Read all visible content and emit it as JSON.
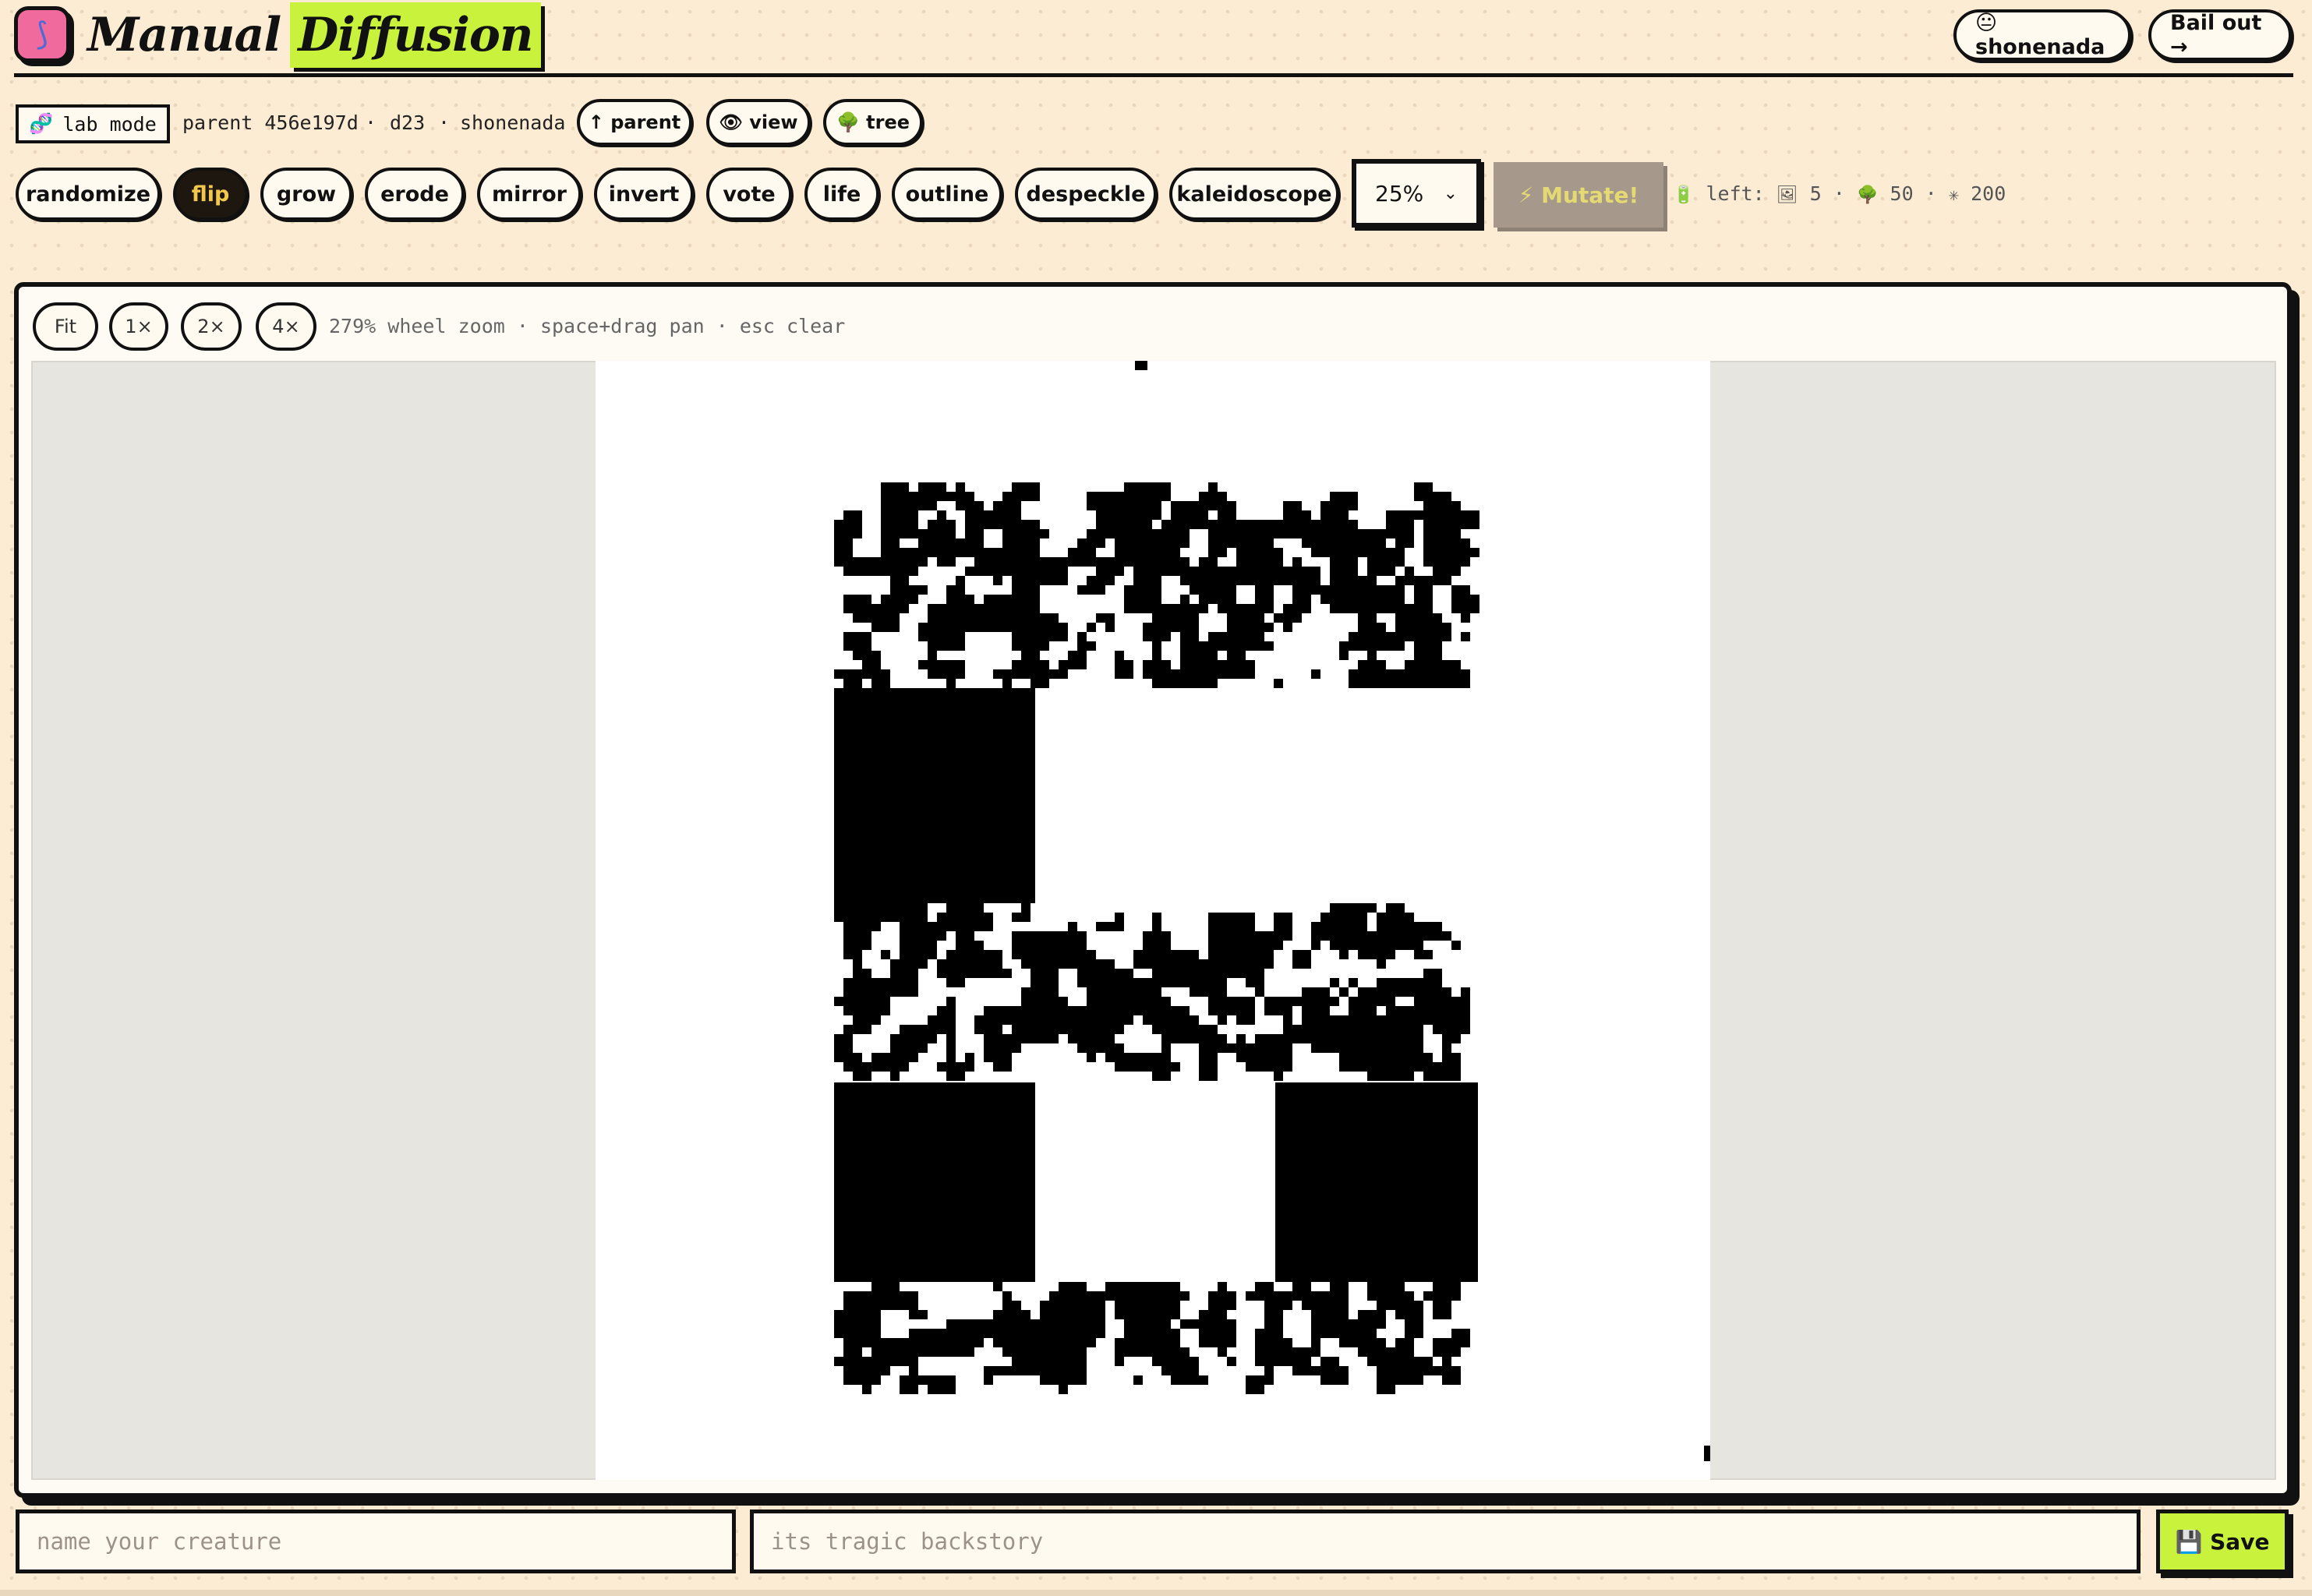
{
  "app": {
    "title_part1": "Manual",
    "title_part2": "Diffusion",
    "logo_icon": "dna-icon"
  },
  "header": {
    "user_label": "😐 shonenada",
    "bail_label": "Bail out →"
  },
  "lineage": {
    "lab_mode_label": "lab mode",
    "lab_mode_icon": "🧬",
    "parent_text": "parent 456e197d",
    "sep1": "·",
    "depth_text": "d23",
    "sep2": "·",
    "author_text": "shonenada",
    "parent_button": "↑ parent",
    "view_button": "👁 view",
    "tree_button": "🌳 tree"
  },
  "operations": [
    {
      "label": "randomize",
      "active": false
    },
    {
      "label": "flip",
      "active": true
    },
    {
      "label": "grow",
      "active": false
    },
    {
      "label": "erode",
      "active": false
    },
    {
      "label": "mirror",
      "active": false
    },
    {
      "label": "invert",
      "active": false
    },
    {
      "label": "vote",
      "active": false
    },
    {
      "label": "life",
      "active": false
    },
    {
      "label": "outline",
      "active": false
    },
    {
      "label": "despeckle",
      "active": false
    },
    {
      "label": "kaleidoscope",
      "active": false
    }
  ],
  "strength": {
    "value": "25%",
    "chevron": "⌄"
  },
  "mutate_label": "⚡ Mutate!",
  "quota": {
    "battery_icon": "🔋",
    "left_label": "left:",
    "image_icon": "🖼",
    "images": "5",
    "sep1": "·",
    "tree_icon": "🌳",
    "trees": "50",
    "sep2": "·",
    "spark_icon": "✳",
    "mutations": "200"
  },
  "zoom": {
    "fit": "Fit",
    "x1": "1×",
    "x2": "2×",
    "x4": "4×",
    "level": "279%",
    "hints": "wheel zoom · space+drag pan · esc clear"
  },
  "form": {
    "name_placeholder": "name your creature",
    "backstory_placeholder": "its tragic backstory",
    "save_label": "💾 Save"
  },
  "colors": {
    "accent_lime": "#c9f23c",
    "logo_pink": "#f06a9e",
    "background": "#fdecd4",
    "ink": "#111111"
  }
}
